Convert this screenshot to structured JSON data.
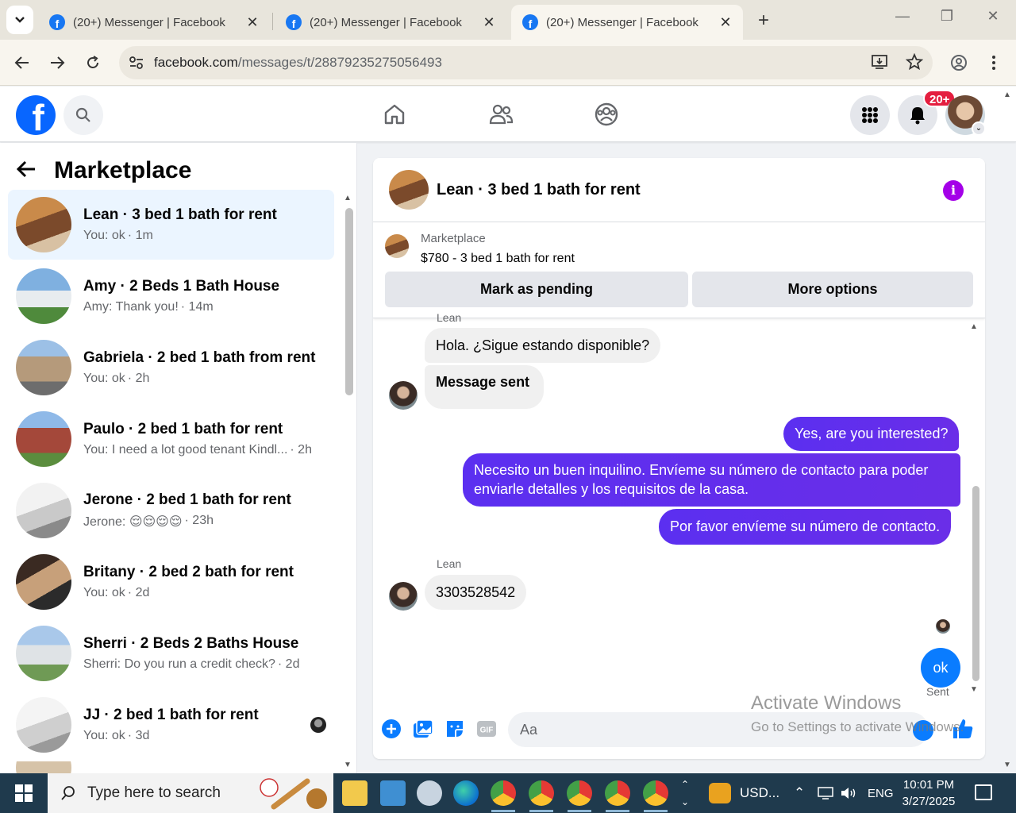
{
  "browser": {
    "tabs": [
      {
        "title": "(20+) Messenger | Facebook"
      },
      {
        "title": "(20+) Messenger | Facebook"
      },
      {
        "title": "(20+) Messenger | Facebook"
      }
    ],
    "url_host": "facebook.com",
    "url_path": "/messages/t/28879235275056493"
  },
  "fb": {
    "notif_count": "20+"
  },
  "sidebar": {
    "title": "Marketplace",
    "conversations": [
      {
        "name": "Lean · 3 bed 1 bath for rent",
        "snippet": "You: ok",
        "time": " · 1m"
      },
      {
        "name": "Amy · 2 Beds 1 Bath House",
        "snippet": "Amy: Thank you!",
        "time": " · 14m"
      },
      {
        "name": "Gabriela · 2 bed 1 bath from rent",
        "snippet": "You: ok",
        "time": " · 2h"
      },
      {
        "name": "Paulo · 2 bed 1 bath for rent",
        "snippet": "You: I need a lot good tenant Kindl...",
        "time": " · 2h"
      },
      {
        "name": "Jerone · 2 bed 1 bath for rent",
        "snippet": "Jerone: 😌😌😌😌",
        "time": " · 23h"
      },
      {
        "name": "Britany · 2 bed 2 bath for rent",
        "snippet": "You: ok",
        "time": " · 2d"
      },
      {
        "name": "Sherri · 2 Beds 2 Baths House",
        "snippet": "Sherri: Do you run a credit check?",
        "time": " · 2d"
      },
      {
        "name": "JJ · 2 bed 1 bath for rent",
        "snippet": "You: ok",
        "time": " · 3d"
      }
    ]
  },
  "chat": {
    "title": "Lean · 3 bed 1 bath for rent",
    "listing_source": "Marketplace",
    "listing_title": "$780 - 3 bed 1 bath for rent",
    "mark_pending": "Mark as pending",
    "more_options": "More options",
    "sender_top": "Lean",
    "messages": {
      "m1": "Hola. ¿Sigue estando disponible?",
      "m2": "Message sent",
      "m3": "Yes, are you interested?",
      "m4_line1": "Necesito un buen inquilino. Envíeme su número de contacto para poder",
      "m4_line2": "enviarle detalles y los requisitos de la casa.",
      "m5": "Por favor envíeme su número de contacto.",
      "sender2": "Lean",
      "m6": "3303528542",
      "m7": "ok",
      "status": "Sent"
    },
    "composer_placeholder": "Aa"
  },
  "watermark": {
    "line1": "Activate Windows",
    "line2": "Go to Settings to activate Windows."
  },
  "taskbar": {
    "search_placeholder": "Type here to search",
    "weather": "USD...",
    "lang": "ENG",
    "time": "10:01 PM",
    "date": "3/27/2025"
  },
  "colors": {
    "fb_blue": "#0866ff",
    "outgoing": "#5b2ff0",
    "active_conv": "#ebf5ff"
  }
}
